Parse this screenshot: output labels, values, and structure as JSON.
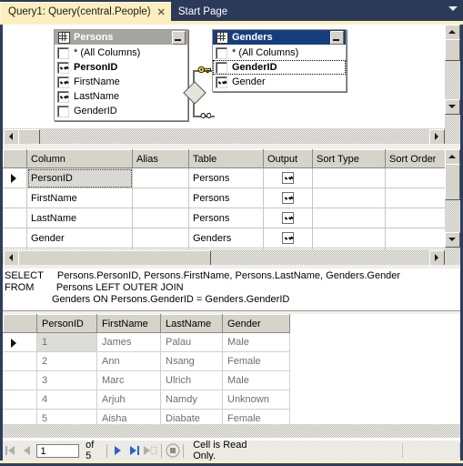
{
  "window": {
    "accent_yellow": "#fdeec0",
    "tabstrip_bg": "#2b3a58",
    "active_title_bg": "#173e7c",
    "inactive_title_bg": "#a5a5a0"
  },
  "tabs": [
    {
      "label": "Query1: Query(central.People)",
      "active": true,
      "close_icon": "✕"
    },
    {
      "label": "Start Page",
      "active": false
    }
  ],
  "tab_dropdown_icon": "chevron-down-icon",
  "diagram": {
    "tables": [
      {
        "name": "Persons",
        "active": false,
        "minimize_label": "–",
        "columns": [
          {
            "label": "* (All Columns)",
            "checked": false,
            "bold": false,
            "focused": false
          },
          {
            "label": "PersonID",
            "checked": true,
            "bold": true,
            "focused": false
          },
          {
            "label": "FirstName",
            "checked": true,
            "bold": false,
            "focused": false
          },
          {
            "label": "LastName",
            "checked": true,
            "bold": false,
            "focused": false
          },
          {
            "label": "GenderID",
            "checked": false,
            "bold": false,
            "focused": false
          }
        ]
      },
      {
        "name": "Genders",
        "active": true,
        "minimize_label": "–",
        "columns": [
          {
            "label": "* (All Columns)",
            "checked": false,
            "bold": false,
            "focused": false
          },
          {
            "label": "GenderID",
            "checked": false,
            "bold": true,
            "focused": true
          },
          {
            "label": "Gender",
            "checked": true,
            "bold": false,
            "focused": false
          }
        ]
      }
    ],
    "join": {
      "left_icon": "infinity-icon",
      "right_icon": "key-icon",
      "type_icon": "left-outer-join-diamond-icon"
    }
  },
  "grid": {
    "headers": [
      "",
      "Column",
      "Alias",
      "Table",
      "Output",
      "Sort Type",
      "Sort Order"
    ],
    "rows": [
      {
        "current": true,
        "column": "PersonID",
        "alias": "",
        "table": "Persons",
        "output": true,
        "sort_type": "",
        "sort_order": ""
      },
      {
        "current": false,
        "column": "FirstName",
        "alias": "",
        "table": "Persons",
        "output": true,
        "sort_type": "",
        "sort_order": ""
      },
      {
        "current": false,
        "column": "LastName",
        "alias": "",
        "table": "Persons",
        "output": true,
        "sort_type": "",
        "sort_order": ""
      },
      {
        "current": false,
        "column": "Gender",
        "alias": "",
        "table": "Genders",
        "output": true,
        "sort_type": "",
        "sort_order": ""
      },
      {
        "current": false,
        "column": "",
        "alias": "",
        "table": "",
        "output": true,
        "sort_type": "",
        "sort_order": ""
      }
    ]
  },
  "sql": {
    "lines": [
      "SELECT     Persons.PersonID, Persons.FirstName, Persons.LastName, Genders.Gender",
      "FROM        Persons LEFT OUTER JOIN",
      "                 Genders ON Persons.GenderID = Genders.GenderID"
    ]
  },
  "results": {
    "headers": [
      "PersonID",
      "FirstName",
      "LastName",
      "Gender"
    ],
    "rows": [
      {
        "current": true,
        "cells": [
          "1",
          "James",
          "Palau",
          "Male"
        ]
      },
      {
        "current": false,
        "cells": [
          "2",
          "Ann",
          "Nsang",
          "Female"
        ]
      },
      {
        "current": false,
        "cells": [
          "3",
          "Marc",
          "Ulrich",
          "Male"
        ]
      },
      {
        "current": false,
        "cells": [
          "4",
          "Arjuh",
          "Namdy",
          "Unknown"
        ]
      },
      {
        "current": false,
        "cells": [
          "5",
          "Aisha",
          "Diabate",
          "Female"
        ]
      }
    ]
  },
  "navigation": {
    "first_label": "first-record",
    "prev_label": "previous-record",
    "page_value": "1",
    "of_label": "of 5",
    "next_label": "next-record",
    "last_label": "last-record",
    "new_label": "new-record",
    "stop_label": "stop",
    "status_text": "Cell is Read Only.",
    "enabled_color": "#2b62c4",
    "disabled_color": "#b0aea7"
  }
}
